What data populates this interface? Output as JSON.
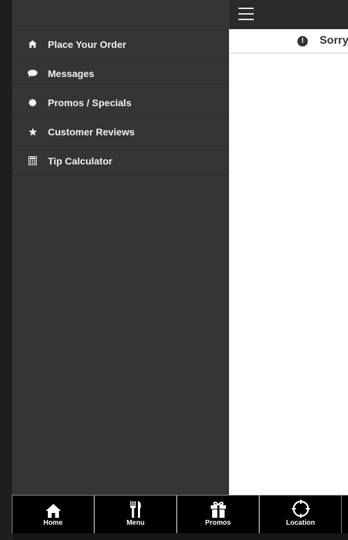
{
  "sidebar": {
    "items": [
      {
        "label": "Place Your Order",
        "icon": "home-icon"
      },
      {
        "label": "Messages",
        "icon": "chat-bubble-icon"
      },
      {
        "label": "Promos / Specials",
        "icon": "badge-icon"
      },
      {
        "label": "Customer Reviews",
        "icon": "star-icon"
      },
      {
        "label": "Tip Calculator",
        "icon": "calculator-icon"
      }
    ]
  },
  "main": {
    "notice": {
      "text": "Sorry",
      "icon": "exclamation-circle-icon"
    }
  },
  "bottom_nav": {
    "tabs": [
      {
        "label": "Home",
        "icon": "home-icon"
      },
      {
        "label": "Menu",
        "icon": "utensils-icon"
      },
      {
        "label": "Promos",
        "icon": "gift-icon"
      },
      {
        "label": "Location",
        "icon": "crosshair-icon"
      }
    ]
  }
}
